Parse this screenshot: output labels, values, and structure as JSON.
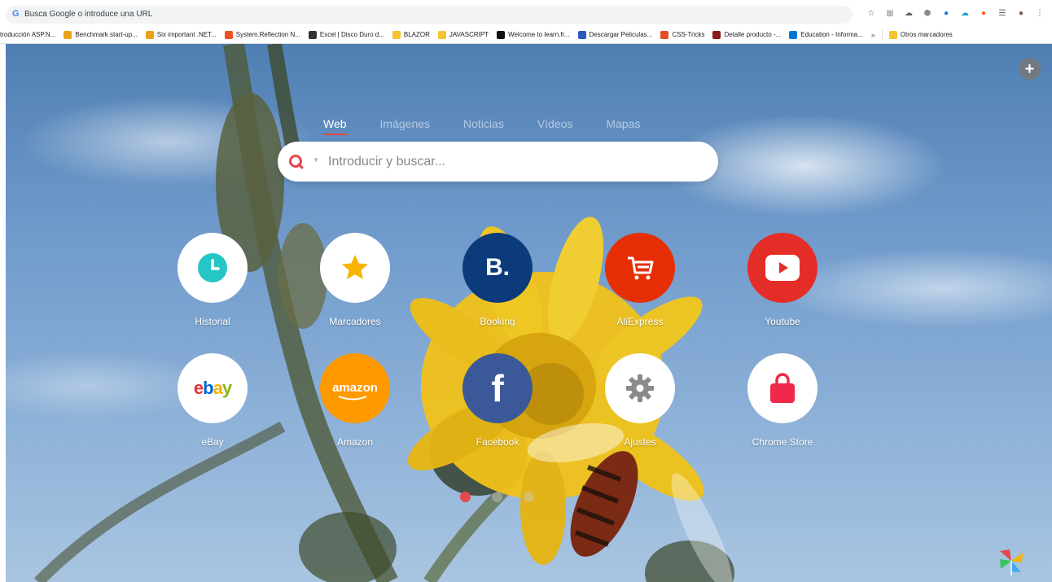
{
  "browser": {
    "url_placeholder": "Busca Google o introduce una URL",
    "google_letter": "G",
    "extensions": [
      {
        "icon": "star-icon",
        "glyph": "☆"
      },
      {
        "icon": "pdf-icon",
        "glyph": "▦"
      },
      {
        "icon": "cloud-icon",
        "glyph": "☁"
      },
      {
        "icon": "shield-icon",
        "glyph": "⬢"
      },
      {
        "icon": "info-icon",
        "glyph": "●"
      },
      {
        "icon": "blue-cloud-icon",
        "glyph": "☁"
      },
      {
        "icon": "orange-ext-icon",
        "glyph": "●"
      },
      {
        "icon": "playlist-icon",
        "glyph": "☰"
      },
      {
        "icon": "avatar-icon",
        "glyph": "●"
      },
      {
        "icon": "more-icon",
        "glyph": "⋮"
      }
    ]
  },
  "bookmarks": {
    "items": [
      {
        "label": "troducción ASP.N...",
        "color": "#ffffff"
      },
      {
        "label": "Benchmark start-up...",
        "color": "#e8a317"
      },
      {
        "label": "Six important .NET...",
        "color": "#e8a317"
      },
      {
        "label": "System.Reflection N...",
        "color": "#f25022"
      },
      {
        "label": "Excel | Disco Duro d...",
        "color": "#333333"
      },
      {
        "label": "BLAZOR",
        "color": "#f4c430"
      },
      {
        "label": "JAVASCRIPT",
        "color": "#f4c430"
      },
      {
        "label": "Welcome to learn.fr...",
        "color": "#111111"
      },
      {
        "label": "Descargar Peliculas...",
        "color": "#2b59c3"
      },
      {
        "label": "CSS-Tricks",
        "color": "#e44d26"
      },
      {
        "label": "Detalle producto -...",
        "color": "#8b1a1a"
      },
      {
        "label": "Education - Informa...",
        "color": "#0078d4"
      }
    ],
    "more": "»",
    "other": "Otros marcadores"
  },
  "search": {
    "tabs": [
      "Web",
      "Imágenes",
      "Noticias",
      "Vídeos",
      "Mapas"
    ],
    "active_tab": "Web",
    "placeholder": "Introducir y buscar...",
    "accent": "#e5484d"
  },
  "tiles": [
    {
      "label": "Historial",
      "icon": "clock-icon",
      "bg": "#ffffff",
      "fg": "#26c6c6"
    },
    {
      "label": "Marcadores",
      "icon": "star-icon",
      "bg": "#ffffff",
      "fg": "#f7b500"
    },
    {
      "label": "Booking",
      "icon": "booking-icon",
      "bg": "#0c3b7c",
      "fg": "#ffffff"
    },
    {
      "label": "AliExpress",
      "icon": "cart-icon",
      "bg": "#e62e04",
      "fg": "#ffffff"
    },
    {
      "label": "Youtube",
      "icon": "youtube-icon",
      "bg": "#e52d27",
      "fg": "#ffffff"
    },
    {
      "label": "eBay",
      "icon": "ebay-icon",
      "bg": "#ffffff",
      "fg": "#0064d2"
    },
    {
      "label": "Amazon",
      "icon": "amazon-icon",
      "bg": "#ff9900",
      "fg": "#ffffff"
    },
    {
      "label": "Facebook",
      "icon": "facebook-icon",
      "bg": "#3b5998",
      "fg": "#ffffff"
    },
    {
      "label": "Ajustes",
      "icon": "gear-icon",
      "bg": "#ffffff",
      "fg": "#8a8a8a"
    },
    {
      "label": "Chrome Store",
      "icon": "bag-icon",
      "bg": "#ffffff",
      "fg": "#f0284a"
    }
  ],
  "brand_text": {
    "booking": "B.",
    "ebay": [
      "e",
      "b",
      "a",
      "y"
    ],
    "amazon": "amazon",
    "facebook": "f"
  },
  "pagination": {
    "pages": 3,
    "current": 1
  }
}
